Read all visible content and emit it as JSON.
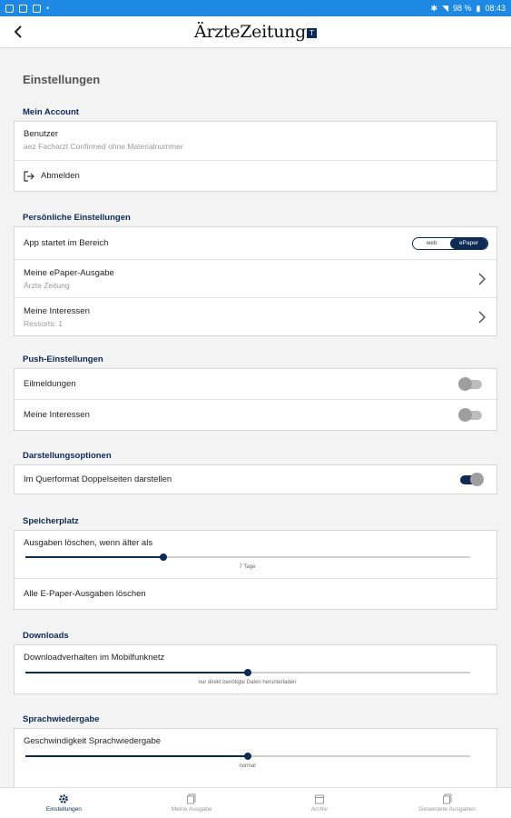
{
  "status_bar": {
    "battery": "98 %",
    "time": "08:43"
  },
  "app_bar": {
    "logo_text": "ÄrzteZeitung",
    "logo_badge": "T"
  },
  "page_title": "Einstellungen",
  "account": {
    "title": "Mein Account",
    "user_label": "Benutzer",
    "user_value": "aez Facharzt Confirmed ohne Materialnummer",
    "logout_label": "Abmelden"
  },
  "personal": {
    "title": "Persönliche Einstellungen",
    "start_area_label": "App startet im Bereich",
    "start_area_options": [
      "web",
      "ePaper"
    ],
    "start_area_selected": "ePaper",
    "epaper_label": "Meine ePaper-Ausgabe",
    "epaper_value": "Ärzte Zeitung",
    "interests_label": "Meine Interessen",
    "interests_value": "Ressorts: 1"
  },
  "push": {
    "title": "Push-Einstellungen",
    "breaking_label": "Eilmeldungen",
    "breaking_on": false,
    "interests_label": "Meine Interessen",
    "interests_on": false
  },
  "display": {
    "title": "Darstellungsoptionen",
    "double_pages_label": "Im Querformat Doppelseiten darstellen",
    "double_pages_on": true
  },
  "storage": {
    "title": "Speicherplatz",
    "delete_older_label": "Ausgaben löschen, wenn älter als",
    "delete_older_value": "7 Tage",
    "delete_older_fraction": 0.31,
    "delete_all_label": "Alle E-Paper-Ausgaben löschen"
  },
  "downloads": {
    "title": "Downloads",
    "mobile_label": "Downloadverhalten im Mobilfunknetz",
    "mobile_value": "nur direkt benötigte Daten herunterladen",
    "mobile_fraction": 0.5
  },
  "speech": {
    "title": "Sprachwiedergabe",
    "speed_label": "Geschwindigkeit Sprachwiedergabe",
    "speed_value": "normal",
    "speed_fraction": 0.5
  },
  "bottom_nav": [
    {
      "label": "Einstellungen",
      "icon": "gear-icon",
      "active": true
    },
    {
      "label": "Meine Ausgabe",
      "icon": "pages-icon",
      "active": false
    },
    {
      "label": "Archiv",
      "icon": "archive-icon",
      "active": false
    },
    {
      "label": "Gesendete Ausgaben",
      "icon": "sent-pages-icon",
      "active": false
    }
  ],
  "colors": {
    "status_bar": "#1e88e5",
    "accent": "#0b2a55",
    "background": "#f3f3f3"
  }
}
